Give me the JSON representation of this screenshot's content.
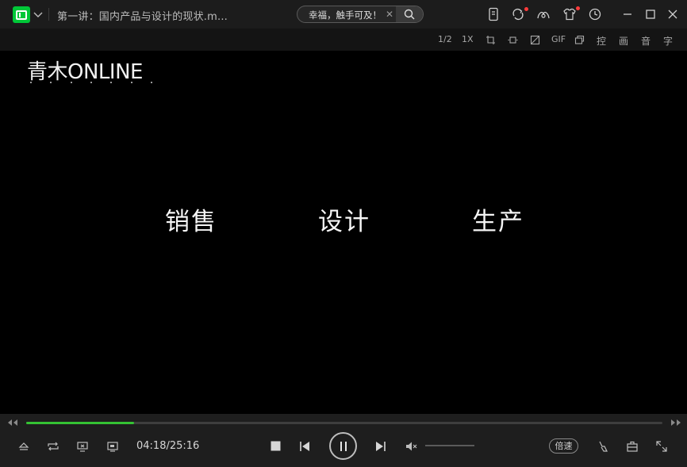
{
  "window": {
    "video_title": "第一讲：国内产品与设计的现状.m...",
    "search_placeholder": "幸福，触手可及！"
  },
  "subbar": {
    "speed_half": "1/2",
    "speed_1x": "1X",
    "gif": "GIF",
    "control": "控",
    "picture": "画",
    "sound": "音",
    "subtitle": "字"
  },
  "video": {
    "brand": "青木ONLINE",
    "words": [
      "销售",
      "设计",
      "生产"
    ]
  },
  "playback": {
    "current_time": "04:18",
    "total_time": "25:16",
    "time_display": "04:18/25:16",
    "progress_fraction": 0.17,
    "volume_fraction": 0.0,
    "speed_label": "倍速"
  },
  "colors": {
    "accent": "#34c233",
    "logo_green": "#00c738",
    "notify_red": "#ff3b3b"
  }
}
